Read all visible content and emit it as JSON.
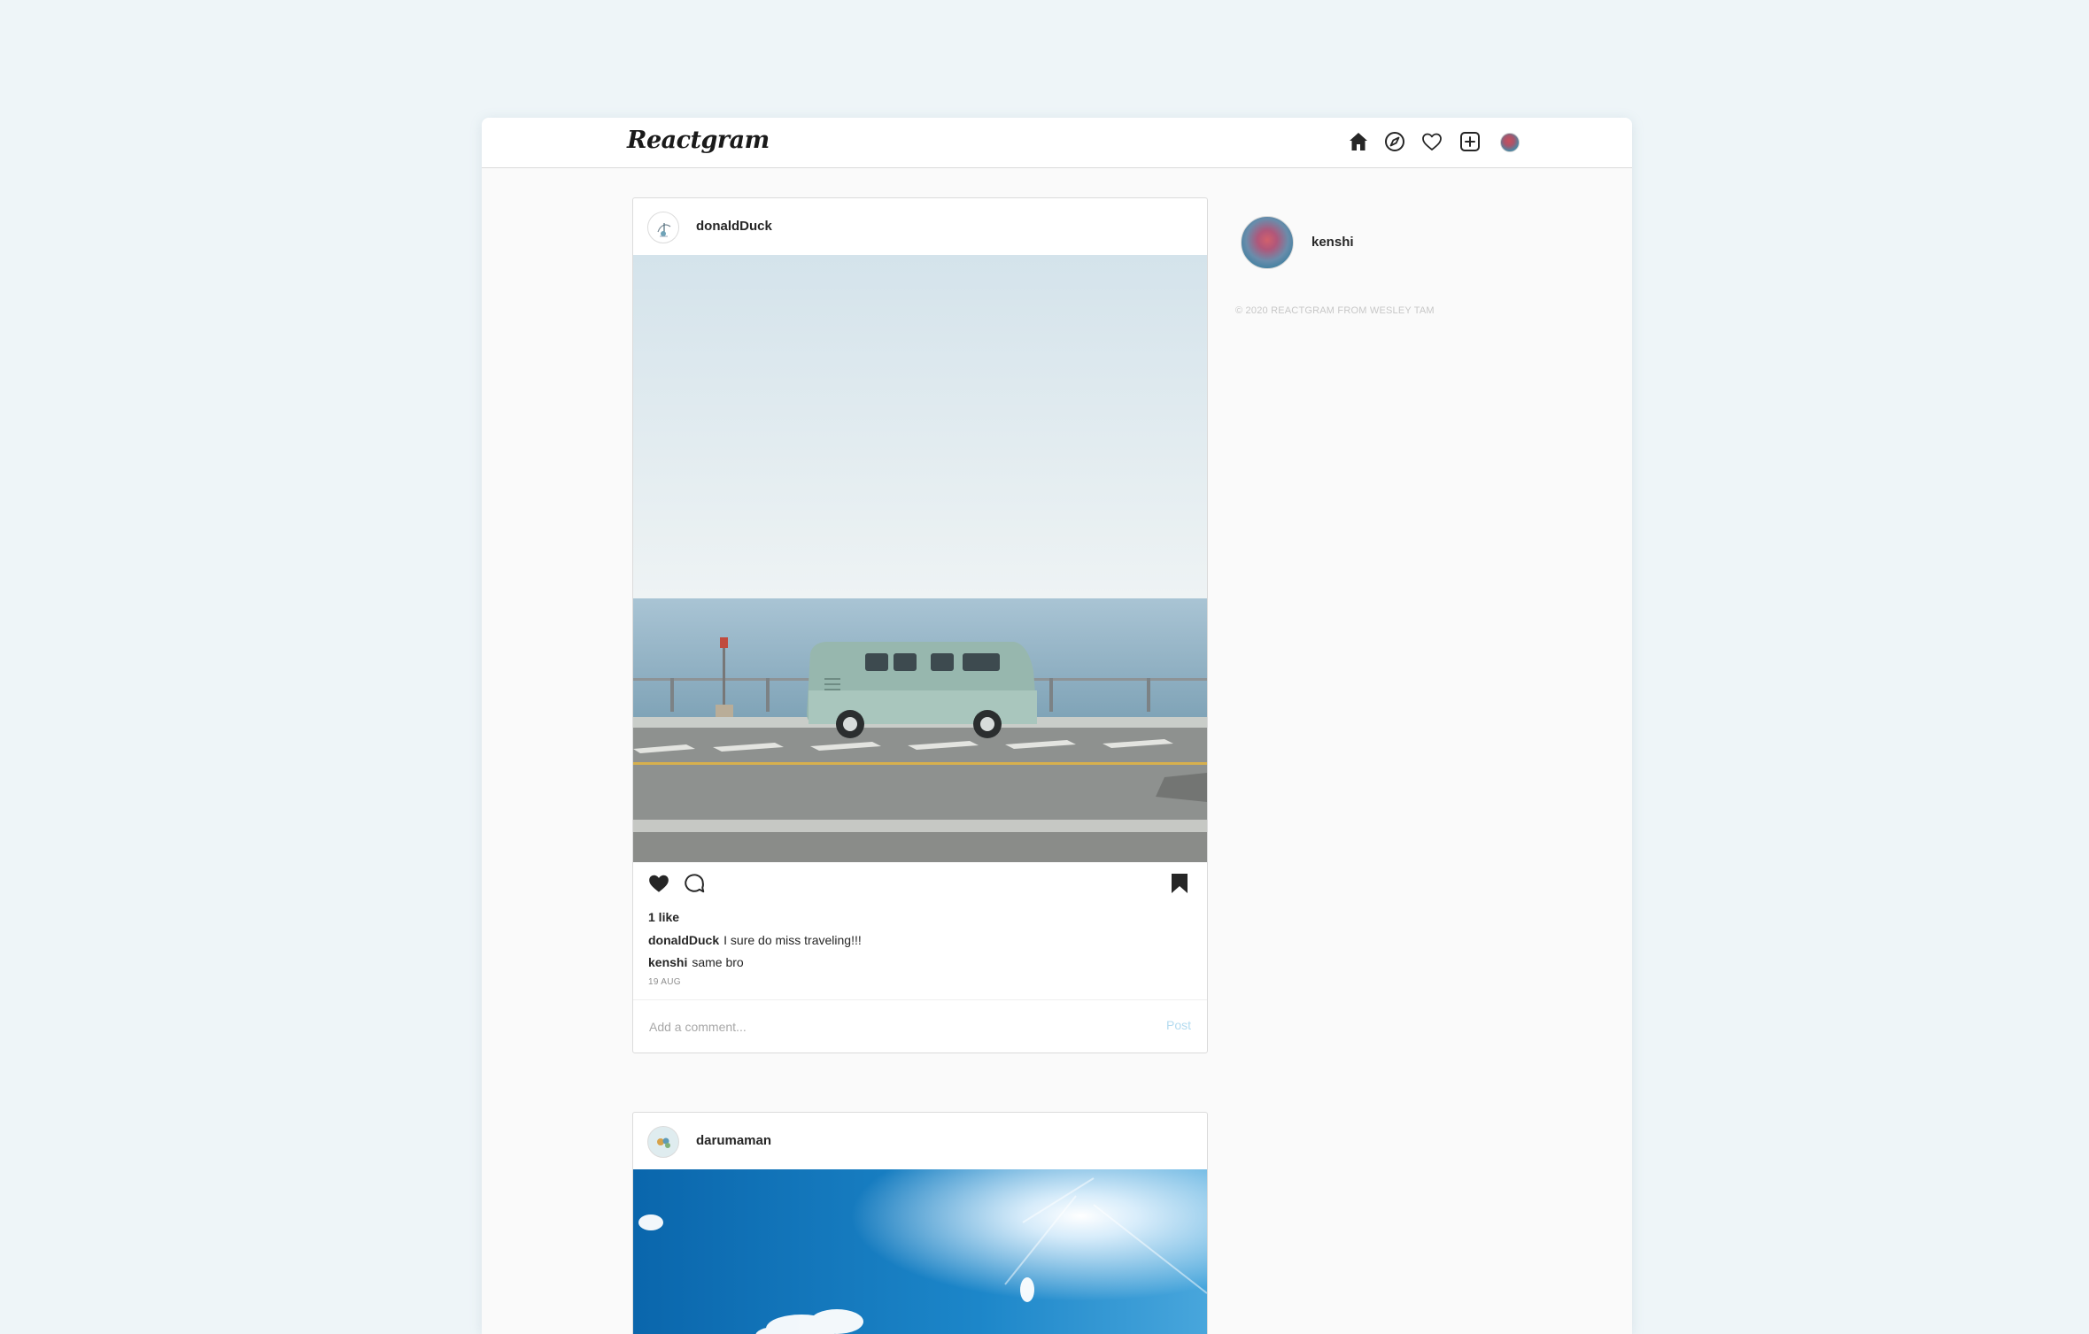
{
  "app": {
    "logo": "Reactgram"
  },
  "nav": {
    "icons": [
      "home-icon",
      "explore-icon",
      "heart-icon",
      "new-post-icon",
      "profile-avatar"
    ]
  },
  "posts": [
    {
      "author": "donaldDuck",
      "likes_text": "1 like",
      "caption": {
        "user": "donaldDuck",
        "text": "I sure do miss traveling!!!"
      },
      "comments": [
        {
          "user": "kenshi",
          "text": "same bro"
        }
      ],
      "date": "19 AUG",
      "comment_placeholder": "Add a comment...",
      "post_label": "Post"
    },
    {
      "author": "darumaman"
    }
  ],
  "sidebar": {
    "username": "kenshi",
    "footer": "© 2020 REACTGRAM FROM WESLEY TAM"
  },
  "colors": {
    "accent_disabled": "#b3dbf0",
    "border": "#dbdbdb",
    "background": "#fafafa"
  }
}
